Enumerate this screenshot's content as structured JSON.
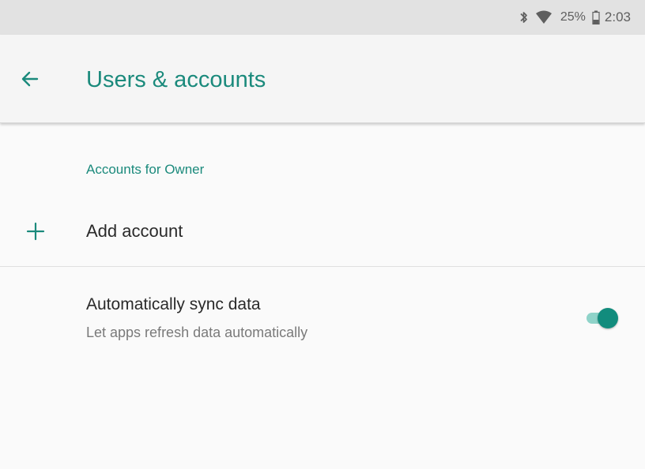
{
  "status_bar": {
    "icons": [
      "bluetooth-icon",
      "wifi-icon",
      "battery-icon"
    ],
    "battery_percent": "25%",
    "time": "2:03"
  },
  "app_bar": {
    "back_icon": "arrow-back-icon",
    "title": "Users & accounts"
  },
  "accounts_section": {
    "header": "Accounts for Owner",
    "add_account": {
      "icon": "plus-icon",
      "label": "Add account"
    }
  },
  "sync_setting": {
    "title": "Automatically sync data",
    "summary": "Let apps refresh data automatically",
    "enabled": true
  },
  "colors": {
    "accent": "#1b8a7c",
    "switch_thumb": "#128c7d",
    "switch_track": "#8fd3c9",
    "status_bar_bg": "#e2e2e2",
    "app_bar_bg": "#f5f5f5",
    "background": "#fafafa"
  }
}
